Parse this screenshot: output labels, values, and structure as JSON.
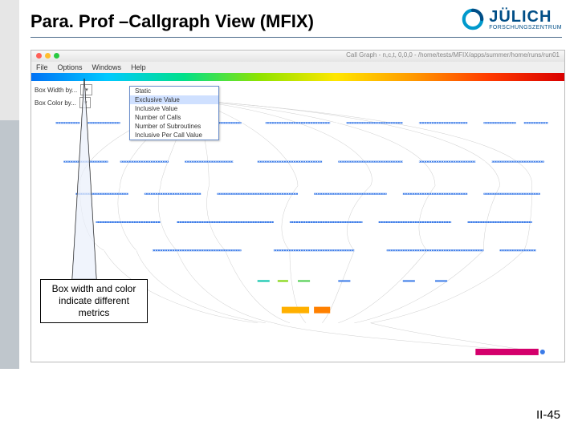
{
  "slide_title": "Para. Prof –Callgraph View (MFIX)",
  "logo": {
    "main": "JÜLICH",
    "sub": "FORSCHUNGSZENTRUM"
  },
  "page_number": "II-45",
  "window": {
    "title": "Call Graph - n,c,t, 0,0,0 - /home/tests/MFIX/apps/summer/home/runs/run01",
    "menus": [
      "File",
      "Options",
      "Windows",
      "Help"
    ],
    "opt1_label": "Box Width by...",
    "opt1_value": "",
    "opt2_label": "Box Color by...",
    "opt2_value": "",
    "popup": {
      "items": [
        "Static",
        "Exclusive Value",
        "Inclusive Value",
        "Number of Calls",
        "Number of Subroutines",
        "Inclusive Per Call Value"
      ],
      "selected_index": 1
    }
  },
  "callout_text": "Box width and color indicate different metrics"
}
